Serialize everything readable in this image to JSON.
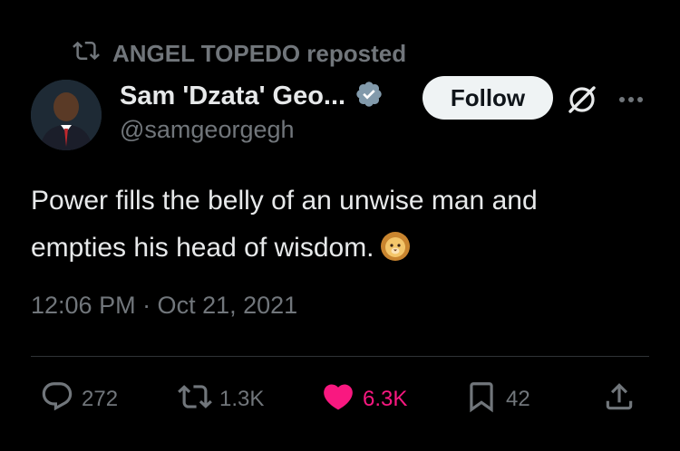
{
  "repost": {
    "icon": "repost-icon",
    "text": "ANGEL TOPEDO reposted"
  },
  "author": {
    "display_name": "Sam 'Dzata' Geo...",
    "handle": "@samgeorgegh",
    "verified_icon": "verified-badge-icon",
    "avatar": "avatar"
  },
  "header_buttons": {
    "follow_label": "Follow",
    "grok_icon": "grok-icon",
    "more_icon": "more-options-icon"
  },
  "tweet": {
    "line1": "Power fills the belly of an unwise man and",
    "line2": "empties his head of wisdom.",
    "emoji": "lion-face-emoji",
    "timestamp": "12:06 PM · Oct 21, 2021"
  },
  "actions": {
    "replies": "272",
    "reposts": "1.3K",
    "likes": "6.3K",
    "bookmarks": "42",
    "share_icon": "share-icon"
  },
  "colors": {
    "background": "#000000",
    "primary_text": "#e7e9ea",
    "secondary_text": "#71767b",
    "like_pink": "#f91880",
    "verified_fill": "#829aab",
    "follow_bg": "#eff3f4"
  }
}
